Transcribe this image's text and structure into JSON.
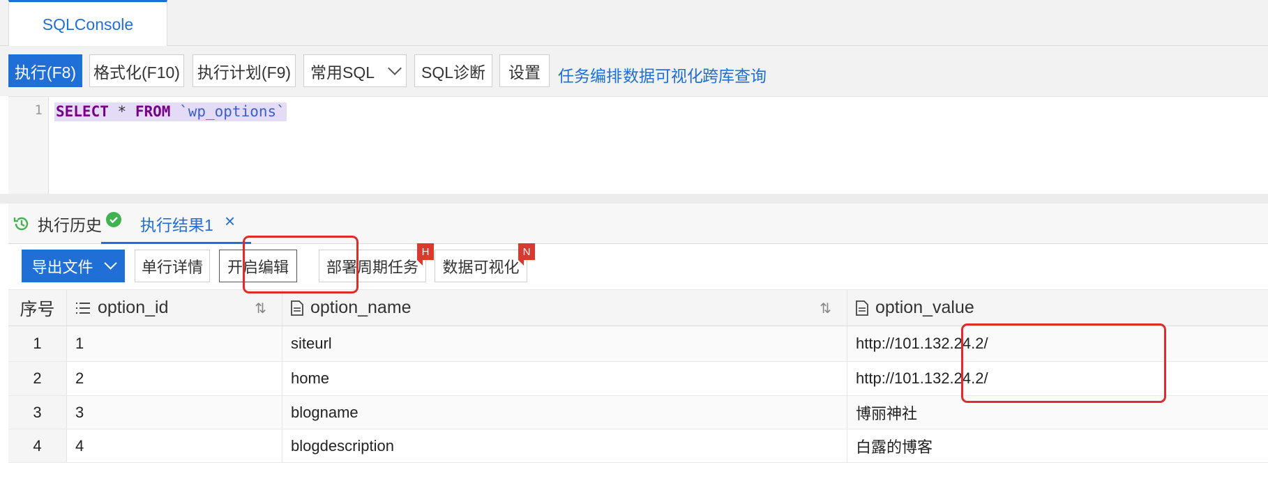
{
  "tabs": [
    {
      "label": "SQLConsole",
      "active": true
    }
  ],
  "toolbar": {
    "execute": "执行(F8)",
    "format": "格式化(F10)",
    "plan": "执行计划(F9)",
    "common_sql": "常用SQL",
    "diagnose": "SQL诊断",
    "settings": "设置",
    "links": [
      "任务编排",
      "数据可视化",
      "跨库查询"
    ]
  },
  "editor": {
    "line_number": "1",
    "tokens": {
      "kw1": "SELECT",
      "star": "*",
      "kw2": "FROM",
      "table": "`wp_options`"
    }
  },
  "result_tabs": {
    "history": "执行历史",
    "result": "执行结果1",
    "close": "×"
  },
  "result_toolbar": {
    "export": "导出文件",
    "row_detail": "单行详情",
    "enable_edit": "开启编辑",
    "deploy": "部署周期任务",
    "deploy_badge": "H",
    "visualize": "数据可视化",
    "visualize_badge": "N"
  },
  "table": {
    "columns": [
      "序号",
      "option_id",
      "option_name",
      "option_value"
    ],
    "rows": [
      [
        "1",
        "1",
        "siteurl",
        "http://101.132.24.2/"
      ],
      [
        "2",
        "2",
        "home",
        "http://101.132.24.2/"
      ],
      [
        "3",
        "3",
        "blogname",
        "博丽神社"
      ],
      [
        "4",
        "4",
        "blogdescription",
        "白露的博客"
      ]
    ]
  },
  "colors": {
    "accent": "#1f6fd6",
    "highlight": "#e02b2b",
    "success": "#3fb34f"
  }
}
